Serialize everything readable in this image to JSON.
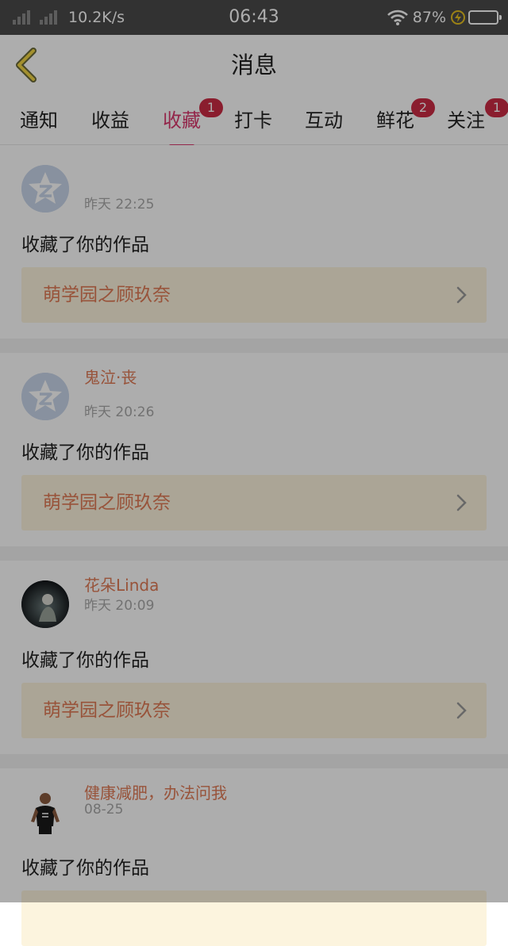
{
  "status_bar": {
    "net_speed": "10.2K/s",
    "time": "06:43",
    "battery_percent": "87%",
    "battery_level": 0.87,
    "icons": [
      "signal-icon",
      "signal-icon",
      "wifi-icon",
      "charging-icon",
      "battery-icon"
    ]
  },
  "header": {
    "back_icon": "chevron-left-icon",
    "title": "消息"
  },
  "tabs": [
    {
      "label": "通知",
      "badge": ""
    },
    {
      "label": "收益",
      "badge": ""
    },
    {
      "label": "收藏",
      "badge": "1",
      "active": true
    },
    {
      "label": "打卡",
      "badge": ""
    },
    {
      "label": "互动",
      "badge": ""
    },
    {
      "label": "鲜花",
      "badge": "2"
    },
    {
      "label": "关注",
      "badge": "1"
    }
  ],
  "colors": {
    "accent": "#d9386e",
    "badge": "#cc2b45",
    "username": "#e07b56",
    "work_box_bg": "#fcf4de"
  },
  "messages": [
    {
      "username": "",
      "time": "昨天 22:25",
      "action": "收藏了你的作品",
      "work_title": "萌学园之顾玖奈",
      "avatar": "default-qq-avatar"
    },
    {
      "username": "鬼泣·丧",
      "time": "昨天 20:26",
      "action": "收藏了你的作品",
      "work_title": "萌学园之顾玖奈",
      "avatar": "default-qq-avatar"
    },
    {
      "username": "花朵Linda",
      "time": "昨天 20:09",
      "action": "收藏了你的作品",
      "work_title": "萌学园之顾玖奈",
      "avatar": "photo-avatar"
    },
    {
      "username": "健康减肥，办法问我",
      "time": "08-25",
      "action": "收藏了你的作品",
      "work_title": "",
      "avatar": "photo-avatar-person"
    }
  ]
}
